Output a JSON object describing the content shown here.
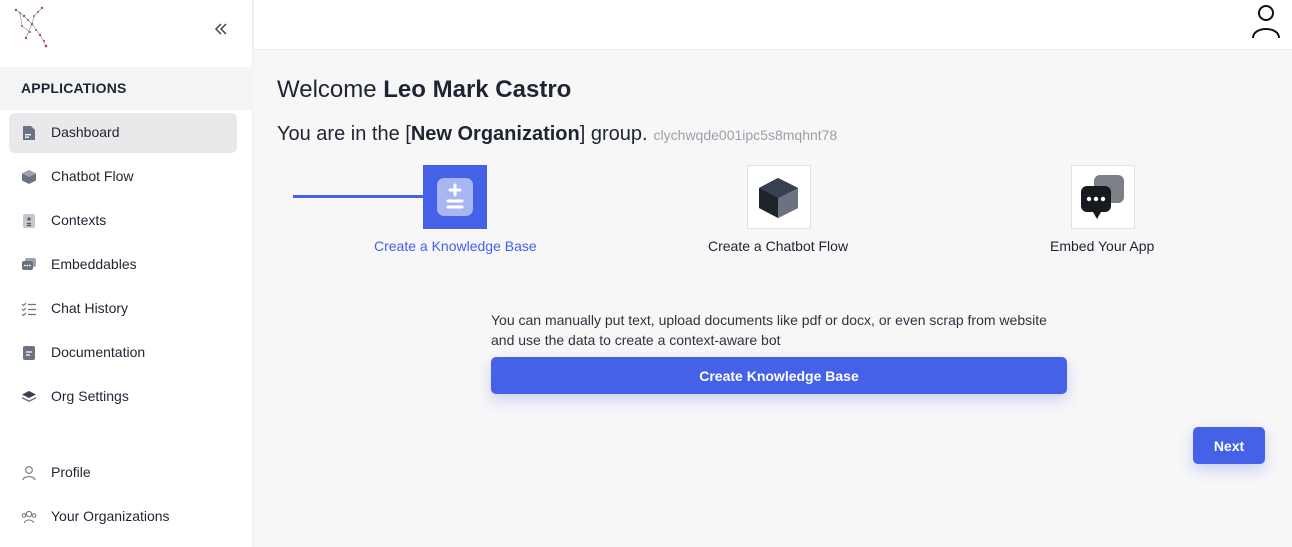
{
  "sidebar": {
    "section_title": "APPLICATIONS",
    "items": [
      {
        "label": "Dashboard",
        "icon": "dashboard-icon",
        "active": true
      },
      {
        "label": "Chatbot Flow",
        "icon": "cube-icon"
      },
      {
        "label": "Contexts",
        "icon": "contexts-icon"
      },
      {
        "label": "Embeddables",
        "icon": "chat-bubble-icon"
      },
      {
        "label": "Chat History",
        "icon": "checklist-icon"
      },
      {
        "label": "Documentation",
        "icon": "document-icon"
      },
      {
        "label": "Org Settings",
        "icon": "layers-icon"
      }
    ],
    "bottom_items": [
      {
        "label": "Profile",
        "icon": "user-icon"
      },
      {
        "label": "Your Organizations",
        "icon": "users-icon"
      }
    ]
  },
  "welcome": {
    "prefix": "Welcome ",
    "name": "Leo Mark Castro"
  },
  "group": {
    "prefix": "You are in the [",
    "name": "New Organization",
    "suffix": "] group.",
    "id": "clychwqde001ipc5s8mqhnt78"
  },
  "steps": [
    {
      "label": "Create a Knowledge Base",
      "icon": "knowledge-base-icon",
      "active": true
    },
    {
      "label": "Create a Chatbot Flow",
      "icon": "cube-icon"
    },
    {
      "label": "Embed Your App",
      "icon": "chat-bubbles-icon"
    }
  ],
  "description_line1": "You can manually put text, upload documents like pdf or docx, or even scrap from website",
  "description_line2": "and use the data to create a context-aware bot",
  "create_button": "Create Knowledge Base",
  "next_button": "Next",
  "colors": {
    "accent": "#4461e8",
    "sidebar_active": "#e9e9eb",
    "background": "#f7f7f8"
  }
}
